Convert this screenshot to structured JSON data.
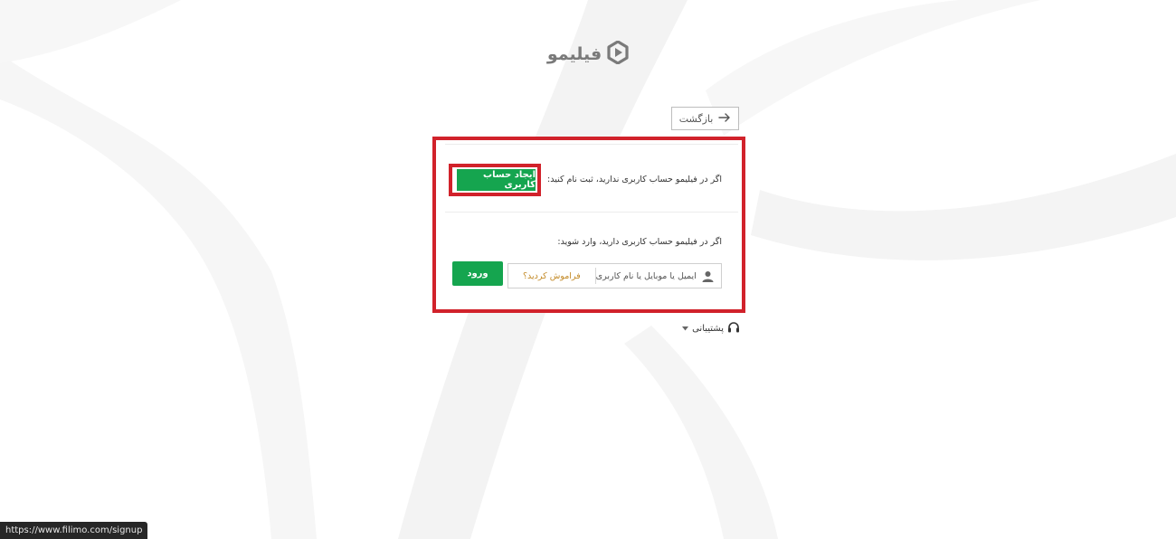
{
  "header": {
    "brand": "فیلیمو"
  },
  "nav": {
    "back_label": "بازگشت"
  },
  "signup": {
    "prompt": "اگر در فیلیمو حساب کاربری ندارید، ثبت نام کنید:",
    "button_label": "ایجاد حساب کاربری"
  },
  "login": {
    "prompt": "اگر در فیلیمو حساب کاربری دارید، وارد شوید:",
    "input_placeholder": "ایمیل یا موبایل یا نام کاربری",
    "forgot_label": "فراموش کردید؟",
    "button_label": "ورود"
  },
  "support": {
    "label": "پشتیبانی"
  },
  "status_bar": {
    "url": "https://www.filimo.com/signup"
  },
  "colors": {
    "accent_green": "#15a54f",
    "highlight_red": "#d1222b",
    "link_orange": "#c38a27"
  },
  "icons": [
    "filimo-play-logo-icon",
    "arrow-right-icon",
    "user-icon",
    "headset-icon",
    "caret-down-icon"
  ]
}
